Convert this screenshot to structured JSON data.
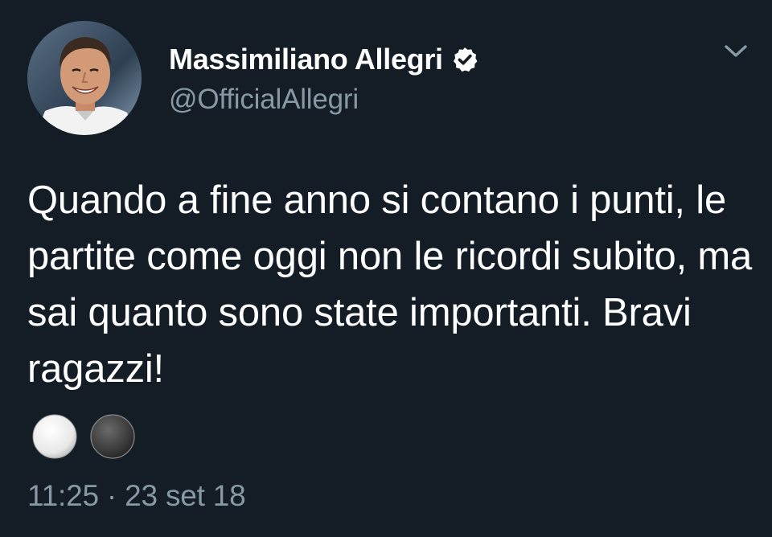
{
  "tweet": {
    "author": {
      "display_name": "Massimiliano Allegri",
      "handle": "@OfficialAllegri",
      "verified": true,
      "avatar": "profile-photo"
    },
    "text": "Quando a fine anno si contano i punti, le partite come oggi non le ricordi subito, ma sai quanto sono state importanti. Bravi ragazzi!",
    "emojis": [
      "white-circle-icon",
      "black-circle-icon"
    ],
    "timestamp": "11:25 · 23 set 18",
    "menu_icon": "chevron-down-icon"
  },
  "colors": {
    "background": "#141d26",
    "primary_text": "#ffffff",
    "secondary_text": "#8899a6",
    "verified_badge": "#ffffff"
  }
}
